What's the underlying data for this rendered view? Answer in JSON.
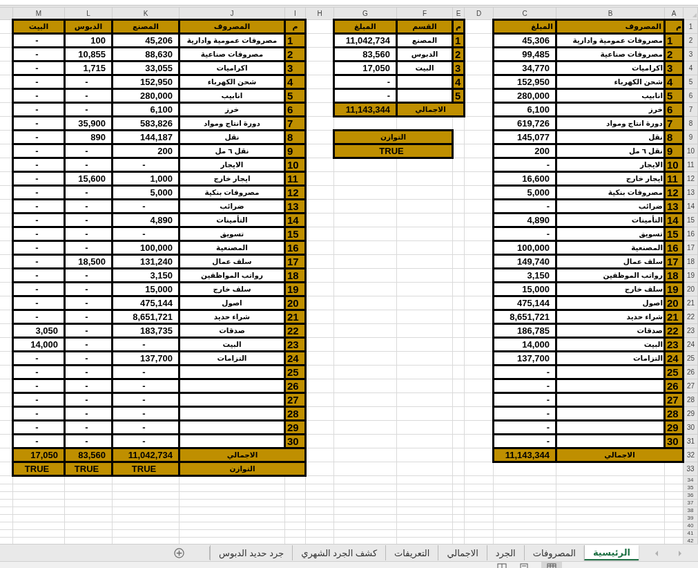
{
  "row_headers": [
    "1",
    "2",
    "3",
    "4",
    "5",
    "6",
    "7",
    "8",
    "9",
    "10",
    "11",
    "12",
    "13",
    "14",
    "15",
    "16",
    "17",
    "18",
    "19",
    "20",
    "21",
    "22",
    "23",
    "24",
    "25",
    "26",
    "27",
    "28",
    "29",
    "30",
    "31",
    "32",
    "33",
    "34",
    "35",
    "36",
    "37",
    "38",
    "39",
    "40",
    "41",
    "42"
  ],
  "column_headers": [
    "A",
    "B",
    "C",
    "D",
    "E",
    "F",
    "G",
    "H",
    "I",
    "J",
    "K",
    "L",
    "M"
  ],
  "main_table": {
    "header": {
      "number": "م",
      "expense": "المصروف",
      "amount": "المبلغ"
    },
    "rows": [
      {
        "number": "1",
        "expense": "مصروفات عمومية وادارية",
        "amount": "45,306"
      },
      {
        "number": "2",
        "expense": "مصروفات صناعية",
        "amount": "99,485"
      },
      {
        "number": "3",
        "expense": "اكراميات",
        "amount": "34,770"
      },
      {
        "number": "4",
        "expense": "شحن الكهرباء",
        "amount": "152,950"
      },
      {
        "number": "5",
        "expense": "انابيب",
        "amount": "280,000"
      },
      {
        "number": "6",
        "expense": "خرز",
        "amount": "6,100"
      },
      {
        "number": "7",
        "expense": "دورة انتاج ومواد",
        "amount": "619,726"
      },
      {
        "number": "8",
        "expense": "نقل",
        "amount": "145,077"
      },
      {
        "number": "9",
        "expense": "نقل ٦ مل",
        "amount": "200"
      },
      {
        "number": "10",
        "expense": "الايجار",
        "amount": "-"
      },
      {
        "number": "11",
        "expense": "ايجار خارج",
        "amount": "16,600"
      },
      {
        "number": "12",
        "expense": "مصروفات بنكية",
        "amount": "5,000"
      },
      {
        "number": "13",
        "expense": "ضرائب",
        "amount": "-"
      },
      {
        "number": "14",
        "expense": "التأمينات",
        "amount": "4,890"
      },
      {
        "number": "15",
        "expense": "تسويق",
        "amount": "-"
      },
      {
        "number": "16",
        "expense": "المصنعية",
        "amount": "100,000"
      },
      {
        "number": "17",
        "expense": "سلف عمال",
        "amount": "149,740"
      },
      {
        "number": "18",
        "expense": "رواتب الموظفين",
        "amount": "3,150"
      },
      {
        "number": "19",
        "expense": "سلف خارج",
        "amount": "15,000"
      },
      {
        "number": "20",
        "expense": "اصول",
        "amount": "475,144"
      },
      {
        "number": "21",
        "expense": "شراء حديد",
        "amount": "8,651,721"
      },
      {
        "number": "22",
        "expense": "صدقات",
        "amount": "186,785"
      },
      {
        "number": "23",
        "expense": "البيت",
        "amount": "14,000"
      },
      {
        "number": "24",
        "expense": "التزامات",
        "amount": "137,700"
      },
      {
        "number": "25",
        "amount": "-"
      },
      {
        "number": "26",
        "amount": "-"
      },
      {
        "number": "27",
        "amount": "-"
      },
      {
        "number": "28",
        "amount": "-"
      },
      {
        "number": "29",
        "amount": "-"
      },
      {
        "number": "30",
        "amount": "-"
      }
    ],
    "total": {
      "label": "الاجمالي",
      "amount": "11,143,344"
    }
  },
  "summary_table": {
    "header": {
      "number": "م",
      "section": "القسم",
      "amount": "المبلغ"
    },
    "rows": [
      {
        "number": "1",
        "section": "المصنع",
        "amount": "11,042,734"
      },
      {
        "number": "2",
        "section": "الدبوس",
        "amount": "83,560"
      },
      {
        "number": "3",
        "section": "البيت",
        "amount": "17,050"
      },
      {
        "number": "4",
        "amount": "-"
      },
      {
        "number": "5",
        "amount": "-"
      }
    ],
    "total": {
      "label": "الاجمالي",
      "amount": "11,143,344"
    },
    "balance": {
      "label": "التوازن",
      "value": "TRUE"
    }
  },
  "detail_table": {
    "header": {
      "number": "م",
      "expense": "المصروف",
      "columns": [
        "المصنع",
        "الدبوس",
        "البيت"
      ]
    },
    "rows": [
      {
        "number": "1",
        "expense": "مصروفات عمومية وادارية",
        "values": [
          "45,206",
          "100",
          "-"
        ]
      },
      {
        "number": "2",
        "expense": "مصروفات صناعية",
        "values": [
          "88,630",
          "10,855",
          "-"
        ]
      },
      {
        "number": "3",
        "expense": "اكراميات",
        "values": [
          "33,055",
          "1,715",
          "-"
        ]
      },
      {
        "number": "4",
        "expense": "شحن الكهرباء",
        "values": [
          "152,950",
          "-",
          "-"
        ]
      },
      {
        "number": "5",
        "expense": "انابيب",
        "values": [
          "280,000",
          "-",
          "-"
        ]
      },
      {
        "number": "6",
        "expense": "خرز",
        "values": [
          "6,100",
          "-",
          "-"
        ]
      },
      {
        "number": "7",
        "expense": "دورة انتاج ومواد",
        "values": [
          "583,826",
          "35,900",
          "-"
        ]
      },
      {
        "number": "8",
        "expense": "نقل",
        "values": [
          "144,187",
          "890",
          "-"
        ]
      },
      {
        "number": "9",
        "expense": "نقل ٦ مل",
        "values": [
          "200",
          "-",
          "-"
        ]
      },
      {
        "number": "10",
        "expense": "الايجار",
        "values": [
          "-",
          "-",
          "-"
        ]
      },
      {
        "number": "11",
        "expense": "ايجار خارج",
        "values": [
          "1,000",
          "15,600",
          "-"
        ]
      },
      {
        "number": "12",
        "expense": "مصروفات بنكية",
        "values": [
          "5,000",
          "-",
          "-"
        ]
      },
      {
        "number": "13",
        "expense": "ضرائب",
        "values": [
          "-",
          "-",
          "-"
        ]
      },
      {
        "number": "14",
        "expense": "التأمينات",
        "values": [
          "4,890",
          "-",
          "-"
        ]
      },
      {
        "number": "15",
        "expense": "تسويق",
        "values": [
          "-",
          "-",
          "-"
        ]
      },
      {
        "number": "16",
        "expense": "المصنعية",
        "values": [
          "100,000",
          "-",
          "-"
        ]
      },
      {
        "number": "17",
        "expense": "سلف عمال",
        "values": [
          "131,240",
          "18,500",
          "-"
        ]
      },
      {
        "number": "18",
        "expense": "رواتب المواظفين",
        "values": [
          "3,150",
          "-",
          "-"
        ]
      },
      {
        "number": "19",
        "expense": "سلف خارج",
        "values": [
          "15,000",
          "-",
          "-"
        ]
      },
      {
        "number": "20",
        "expense": "اصول",
        "values": [
          "475,144",
          "-",
          "-"
        ]
      },
      {
        "number": "21",
        "expense": "شراء حديد",
        "values": [
          "8,651,721",
          "-",
          "-"
        ]
      },
      {
        "number": "22",
        "expense": "صدقات",
        "values": [
          "183,735",
          "-",
          "3,050"
        ]
      },
      {
        "number": "23",
        "expense": "البيت",
        "values": [
          "-",
          "-",
          "14,000"
        ]
      },
      {
        "number": "24",
        "expense": "التزامات",
        "values": [
          "137,700",
          "-",
          "-"
        ]
      },
      {
        "number": "25",
        "values": [
          "-",
          "-",
          "-"
        ]
      },
      {
        "number": "26",
        "values": [
          "-",
          "-",
          "-"
        ]
      },
      {
        "number": "27",
        "values": [
          "-",
          "-",
          "-"
        ]
      },
      {
        "number": "28",
        "values": [
          "-",
          "-",
          "-"
        ]
      },
      {
        "number": "29",
        "values": [
          "-",
          "-",
          "-"
        ]
      },
      {
        "number": "30",
        "values": [
          "-",
          "-",
          "-"
        ]
      }
    ],
    "total": {
      "label": "الاجمالي",
      "values": [
        "11,042,734",
        "83,560",
        "17,050"
      ]
    },
    "balance": {
      "label": "التوازن",
      "values": [
        "TRUE",
        "TRUE",
        "TRUE"
      ]
    }
  },
  "sheet_tabs": [
    {
      "label": "الرئيسية",
      "selected": true
    },
    {
      "label": "المصروفات",
      "selected": false
    },
    {
      "label": "الجرد",
      "selected": false
    },
    {
      "label": "الاجمالي",
      "selected": false
    },
    {
      "label": "التعريفات",
      "selected": false
    },
    {
      "label": "كشف الجرد الشهري",
      "selected": false
    },
    {
      "label": "جرد حديد الدبوس",
      "selected": false
    }
  ]
}
